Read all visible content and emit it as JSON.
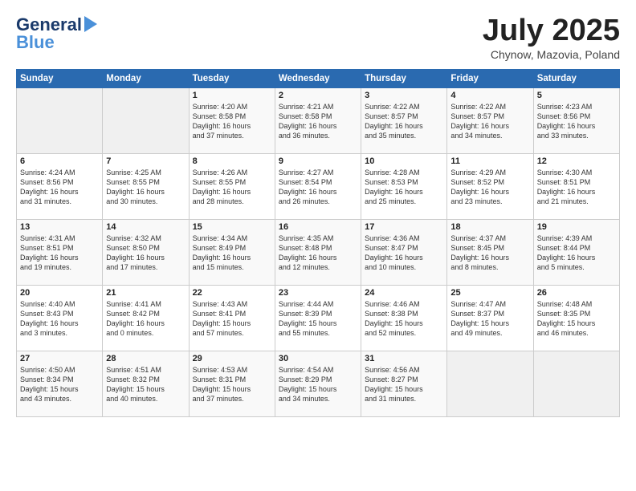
{
  "header": {
    "logo_general": "General",
    "logo_blue": "Blue",
    "month_title": "July 2025",
    "location": "Chynow, Mazovia, Poland"
  },
  "weekdays": [
    "Sunday",
    "Monday",
    "Tuesday",
    "Wednesday",
    "Thursday",
    "Friday",
    "Saturday"
  ],
  "weeks": [
    [
      {
        "day": "",
        "text": ""
      },
      {
        "day": "",
        "text": ""
      },
      {
        "day": "1",
        "text": "Sunrise: 4:20 AM\nSunset: 8:58 PM\nDaylight: 16 hours\nand 37 minutes."
      },
      {
        "day": "2",
        "text": "Sunrise: 4:21 AM\nSunset: 8:58 PM\nDaylight: 16 hours\nand 36 minutes."
      },
      {
        "day": "3",
        "text": "Sunrise: 4:22 AM\nSunset: 8:57 PM\nDaylight: 16 hours\nand 35 minutes."
      },
      {
        "day": "4",
        "text": "Sunrise: 4:22 AM\nSunset: 8:57 PM\nDaylight: 16 hours\nand 34 minutes."
      },
      {
        "day": "5",
        "text": "Sunrise: 4:23 AM\nSunset: 8:56 PM\nDaylight: 16 hours\nand 33 minutes."
      }
    ],
    [
      {
        "day": "6",
        "text": "Sunrise: 4:24 AM\nSunset: 8:56 PM\nDaylight: 16 hours\nand 31 minutes."
      },
      {
        "day": "7",
        "text": "Sunrise: 4:25 AM\nSunset: 8:55 PM\nDaylight: 16 hours\nand 30 minutes."
      },
      {
        "day": "8",
        "text": "Sunrise: 4:26 AM\nSunset: 8:55 PM\nDaylight: 16 hours\nand 28 minutes."
      },
      {
        "day": "9",
        "text": "Sunrise: 4:27 AM\nSunset: 8:54 PM\nDaylight: 16 hours\nand 26 minutes."
      },
      {
        "day": "10",
        "text": "Sunrise: 4:28 AM\nSunset: 8:53 PM\nDaylight: 16 hours\nand 25 minutes."
      },
      {
        "day": "11",
        "text": "Sunrise: 4:29 AM\nSunset: 8:52 PM\nDaylight: 16 hours\nand 23 minutes."
      },
      {
        "day": "12",
        "text": "Sunrise: 4:30 AM\nSunset: 8:51 PM\nDaylight: 16 hours\nand 21 minutes."
      }
    ],
    [
      {
        "day": "13",
        "text": "Sunrise: 4:31 AM\nSunset: 8:51 PM\nDaylight: 16 hours\nand 19 minutes."
      },
      {
        "day": "14",
        "text": "Sunrise: 4:32 AM\nSunset: 8:50 PM\nDaylight: 16 hours\nand 17 minutes."
      },
      {
        "day": "15",
        "text": "Sunrise: 4:34 AM\nSunset: 8:49 PM\nDaylight: 16 hours\nand 15 minutes."
      },
      {
        "day": "16",
        "text": "Sunrise: 4:35 AM\nSunset: 8:48 PM\nDaylight: 16 hours\nand 12 minutes."
      },
      {
        "day": "17",
        "text": "Sunrise: 4:36 AM\nSunset: 8:47 PM\nDaylight: 16 hours\nand 10 minutes."
      },
      {
        "day": "18",
        "text": "Sunrise: 4:37 AM\nSunset: 8:45 PM\nDaylight: 16 hours\nand 8 minutes."
      },
      {
        "day": "19",
        "text": "Sunrise: 4:39 AM\nSunset: 8:44 PM\nDaylight: 16 hours\nand 5 minutes."
      }
    ],
    [
      {
        "day": "20",
        "text": "Sunrise: 4:40 AM\nSunset: 8:43 PM\nDaylight: 16 hours\nand 3 minutes."
      },
      {
        "day": "21",
        "text": "Sunrise: 4:41 AM\nSunset: 8:42 PM\nDaylight: 16 hours\nand 0 minutes."
      },
      {
        "day": "22",
        "text": "Sunrise: 4:43 AM\nSunset: 8:41 PM\nDaylight: 15 hours\nand 57 minutes."
      },
      {
        "day": "23",
        "text": "Sunrise: 4:44 AM\nSunset: 8:39 PM\nDaylight: 15 hours\nand 55 minutes."
      },
      {
        "day": "24",
        "text": "Sunrise: 4:46 AM\nSunset: 8:38 PM\nDaylight: 15 hours\nand 52 minutes."
      },
      {
        "day": "25",
        "text": "Sunrise: 4:47 AM\nSunset: 8:37 PM\nDaylight: 15 hours\nand 49 minutes."
      },
      {
        "day": "26",
        "text": "Sunrise: 4:48 AM\nSunset: 8:35 PM\nDaylight: 15 hours\nand 46 minutes."
      }
    ],
    [
      {
        "day": "27",
        "text": "Sunrise: 4:50 AM\nSunset: 8:34 PM\nDaylight: 15 hours\nand 43 minutes."
      },
      {
        "day": "28",
        "text": "Sunrise: 4:51 AM\nSunset: 8:32 PM\nDaylight: 15 hours\nand 40 minutes."
      },
      {
        "day": "29",
        "text": "Sunrise: 4:53 AM\nSunset: 8:31 PM\nDaylight: 15 hours\nand 37 minutes."
      },
      {
        "day": "30",
        "text": "Sunrise: 4:54 AM\nSunset: 8:29 PM\nDaylight: 15 hours\nand 34 minutes."
      },
      {
        "day": "31",
        "text": "Sunrise: 4:56 AM\nSunset: 8:27 PM\nDaylight: 15 hours\nand 31 minutes."
      },
      {
        "day": "",
        "text": ""
      },
      {
        "day": "",
        "text": ""
      }
    ]
  ]
}
